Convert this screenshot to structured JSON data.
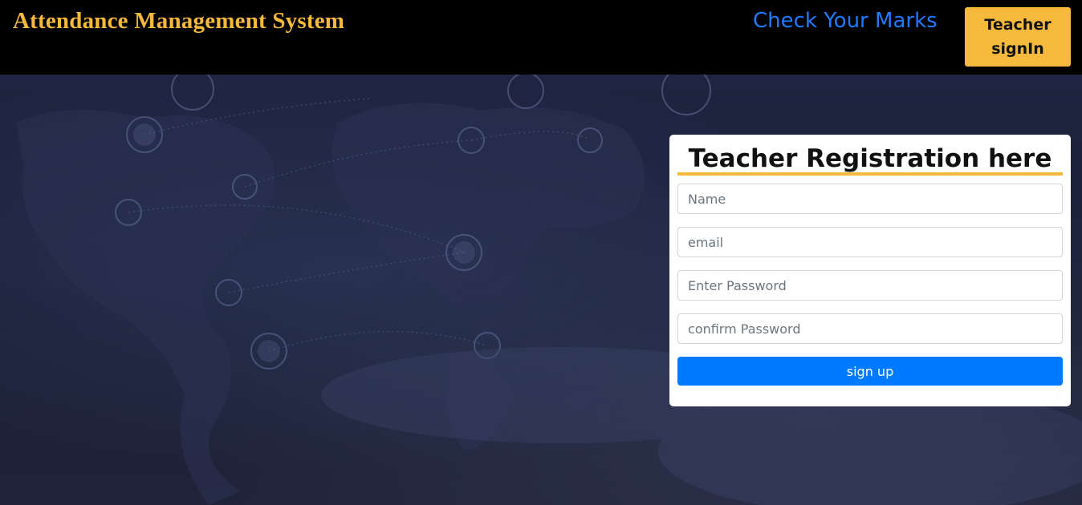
{
  "header": {
    "brand": "Attendance Management System",
    "marks_link": "Check Your Marks",
    "signin_button": "Teacher signIn"
  },
  "registration": {
    "title": "Teacher Registration here",
    "fields": {
      "name": {
        "placeholder": "Name",
        "value": ""
      },
      "email": {
        "placeholder": "email",
        "value": ""
      },
      "password": {
        "placeholder": "Enter Password",
        "value": ""
      },
      "confirm_password": {
        "placeholder": "confirm Password",
        "value": ""
      }
    },
    "submit_label": "sign up"
  },
  "colors": {
    "brand": "#f7b93b",
    "link": "#1e7bff",
    "primary": "#007bff",
    "navbar": "#000000",
    "hero": "#1a1f33"
  },
  "background": {
    "image": "world-network-map"
  }
}
